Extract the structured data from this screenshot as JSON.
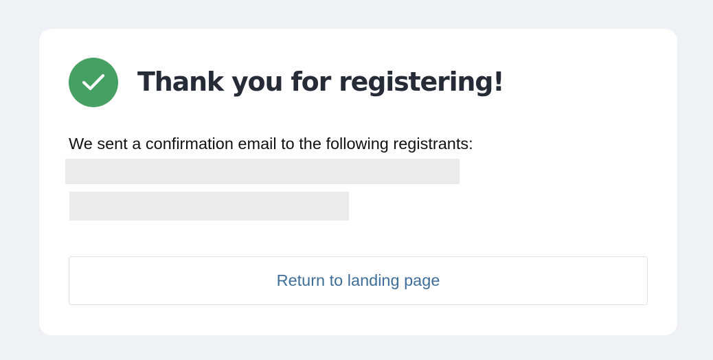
{
  "colors": {
    "page_background": "#eef2f6",
    "card_background": "#ffffff",
    "success": "#46a063",
    "title": "#262b38",
    "body_text": "#111111",
    "link": "#3e6e99",
    "redaction": "#ebebeb"
  },
  "confirmation": {
    "icon": "checkmark-icon",
    "title": "Thank you for registering!",
    "message": "We sent a confirmation email to the following registrants:",
    "registrants_redacted": 2
  },
  "actions": {
    "return_label": "Return to landing page"
  }
}
